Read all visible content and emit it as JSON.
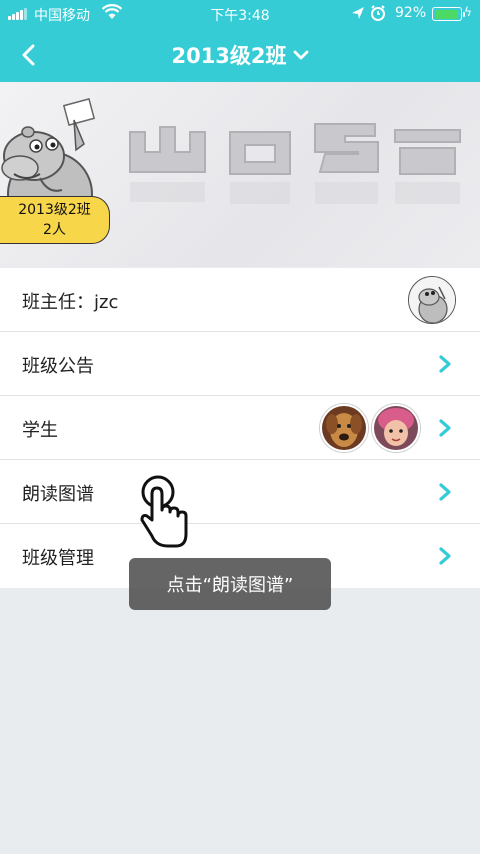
{
  "status_bar": {
    "carrier": "中国移动",
    "time": "下午3:48",
    "battery": "92%",
    "battery_level": 0.92
  },
  "nav": {
    "title": "2013级2班",
    "back_icon": "chevron-left-icon",
    "dropdown_icon": "chevron-down-icon"
  },
  "banner": {
    "badge_class": "2013级2班",
    "badge_count": "2人"
  },
  "rows": {
    "teacher_label": "班主任：jzc",
    "announcement_label": "班级公告",
    "students_label": "学生",
    "reading_map_label": "朗读图谱",
    "manage_label": "班级管理"
  },
  "guide": {
    "toast": "点击“朗读图谱”"
  },
  "colors": {
    "accent": "#35ccd6",
    "badge": "#f7d64a"
  }
}
